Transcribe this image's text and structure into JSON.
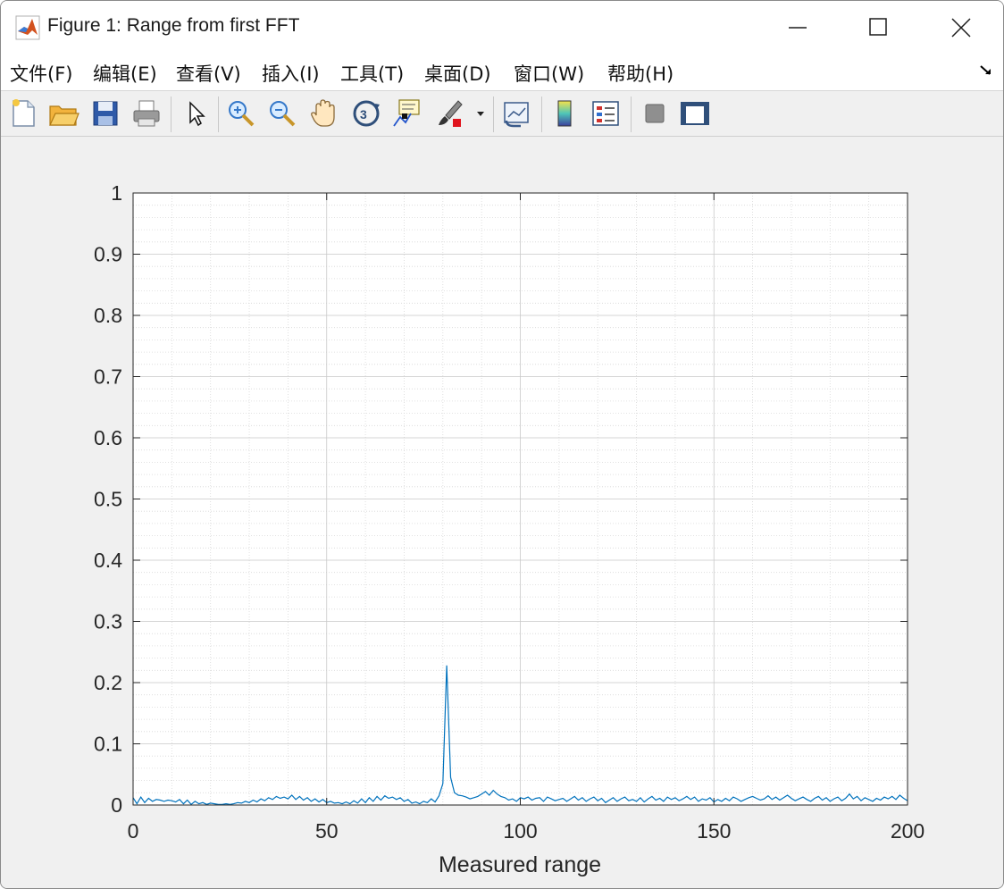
{
  "window": {
    "title": "Figure 1: Range from first FFT"
  },
  "menubar": {
    "items": [
      {
        "label": "文件(F)",
        "shortcut": "F"
      },
      {
        "label": "编辑(E)",
        "shortcut": "E"
      },
      {
        "label": "查看(V)",
        "shortcut": "V"
      },
      {
        "label": "插入(I)",
        "shortcut": "I"
      },
      {
        "label": "工具(T)",
        "shortcut": "T"
      },
      {
        "label": "桌面(D)",
        "shortcut": "D"
      },
      {
        "label": "窗口(W)",
        "shortcut": "W"
      },
      {
        "label": "帮助(H)",
        "shortcut": "H"
      }
    ]
  },
  "toolbar": {
    "buttons": [
      "new-figure-icon",
      "open-file-icon",
      "save-icon",
      "print-icon",
      "pointer-icon",
      "zoom-in-icon",
      "zoom-out-icon",
      "pan-hand-icon",
      "rotate-3d-icon",
      "data-cursor-icon",
      "brush-icon",
      "link-plot-icon",
      "colorbar-icon",
      "legend-icon",
      "hide-plot-tools-icon",
      "show-plot-tools-icon"
    ]
  },
  "chart_data": {
    "type": "line",
    "title": "",
    "xlabel": "Measured range",
    "ylabel": "",
    "xlim": [
      0,
      200
    ],
    "ylim": [
      0,
      1
    ],
    "grid": "minor",
    "xticks": [
      "0",
      "50",
      "100",
      "150",
      "200"
    ],
    "yticks": [
      "0",
      "0.1",
      "0.2",
      "0.3",
      "0.4",
      "0.5",
      "0.6",
      "0.7",
      "0.8",
      "0.9",
      "1"
    ],
    "line_color": "#0072bd",
    "x": [
      0,
      1,
      2,
      3,
      4,
      5,
      6,
      7,
      8,
      9,
      10,
      11,
      12,
      13,
      14,
      15,
      16,
      17,
      18,
      19,
      20,
      21,
      22,
      23,
      24,
      25,
      26,
      27,
      28,
      29,
      30,
      31,
      32,
      33,
      34,
      35,
      36,
      37,
      38,
      39,
      40,
      41,
      42,
      43,
      44,
      45,
      46,
      47,
      48,
      49,
      50,
      51,
      52,
      53,
      54,
      55,
      56,
      57,
      58,
      59,
      60,
      61,
      62,
      63,
      64,
      65,
      66,
      67,
      68,
      69,
      70,
      71,
      72,
      73,
      74,
      75,
      76,
      77,
      78,
      79,
      80,
      81,
      82,
      83,
      84,
      85,
      86,
      87,
      88,
      89,
      90,
      91,
      92,
      93,
      94,
      95,
      96,
      97,
      98,
      99,
      100,
      101,
      102,
      103,
      104,
      105,
      106,
      107,
      108,
      109,
      110,
      111,
      112,
      113,
      114,
      115,
      116,
      117,
      118,
      119,
      120,
      121,
      122,
      123,
      124,
      125,
      126,
      127,
      128,
      129,
      130,
      131,
      132,
      133,
      134,
      135,
      136,
      137,
      138,
      139,
      140,
      141,
      142,
      143,
      144,
      145,
      146,
      147,
      148,
      149,
      150,
      151,
      152,
      153,
      154,
      155,
      156,
      157,
      158,
      159,
      160,
      161,
      162,
      163,
      164,
      165,
      166,
      167,
      168,
      169,
      170,
      171,
      172,
      173,
      174,
      175,
      176,
      177,
      178,
      179,
      180,
      181,
      182,
      183,
      184,
      185,
      186,
      187,
      188,
      189,
      190,
      191,
      192,
      193,
      194,
      195,
      196,
      197,
      198,
      199,
      200
    ],
    "y": [
      0.012,
      0.002,
      0.013,
      0.004,
      0.011,
      0.006,
      0.009,
      0.008,
      0.006,
      0.008,
      0.007,
      0.005,
      0.009,
      0.002,
      0.008,
      0.001,
      0.006,
      0.002,
      0.004,
      0.001,
      0.003,
      0.002,
      0.001,
      0.001,
      0.002,
      0.001,
      0.002,
      0.004,
      0.003,
      0.006,
      0.004,
      0.008,
      0.005,
      0.01,
      0.007,
      0.012,
      0.009,
      0.014,
      0.011,
      0.013,
      0.01,
      0.016,
      0.009,
      0.014,
      0.008,
      0.012,
      0.006,
      0.01,
      0.005,
      0.009,
      0.004,
      0.006,
      0.003,
      0.004,
      0.002,
      0.005,
      0.002,
      0.007,
      0.003,
      0.01,
      0.004,
      0.012,
      0.006,
      0.014,
      0.008,
      0.015,
      0.011,
      0.013,
      0.009,
      0.012,
      0.006,
      0.009,
      0.003,
      0.005,
      0.002,
      0.006,
      0.004,
      0.01,
      0.005,
      0.015,
      0.035,
      0.228,
      0.045,
      0.02,
      0.016,
      0.015,
      0.013,
      0.01,
      0.012,
      0.014,
      0.018,
      0.022,
      0.016,
      0.024,
      0.018,
      0.014,
      0.012,
      0.008,
      0.01,
      0.006,
      0.012,
      0.01,
      0.013,
      0.008,
      0.011,
      0.012,
      0.006,
      0.013,
      0.01,
      0.007,
      0.009,
      0.011,
      0.006,
      0.01,
      0.014,
      0.008,
      0.012,
      0.006,
      0.01,
      0.013,
      0.007,
      0.011,
      0.004,
      0.008,
      0.012,
      0.006,
      0.01,
      0.013,
      0.007,
      0.009,
      0.006,
      0.012,
      0.005,
      0.01,
      0.014,
      0.008,
      0.011,
      0.006,
      0.013,
      0.009,
      0.012,
      0.007,
      0.01,
      0.014,
      0.009,
      0.013,
      0.006,
      0.01,
      0.008,
      0.012,
      0.005,
      0.009,
      0.006,
      0.011,
      0.007,
      0.013,
      0.01,
      0.006,
      0.009,
      0.012,
      0.014,
      0.011,
      0.008,
      0.01,
      0.015,
      0.009,
      0.013,
      0.008,
      0.012,
      0.016,
      0.011,
      0.007,
      0.01,
      0.013,
      0.009,
      0.006,
      0.011,
      0.014,
      0.008,
      0.012,
      0.006,
      0.01,
      0.013,
      0.007,
      0.011,
      0.018,
      0.01,
      0.014,
      0.007,
      0.012,
      0.009,
      0.006,
      0.011,
      0.008,
      0.013,
      0.01,
      0.014,
      0.009,
      0.016,
      0.011,
      0.007,
      0.012,
      0.015,
      0.01,
      0.006
    ]
  }
}
